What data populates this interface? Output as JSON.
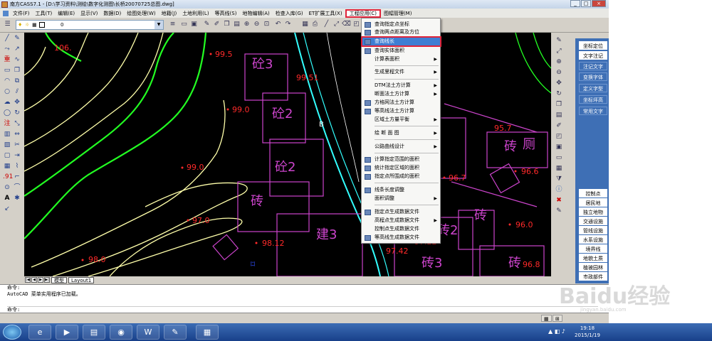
{
  "window": {
    "title": "南方CASS7.1 - [D:\\学习资料\\测绘\\数字化测图\\长桥20070725总图.dwg]",
    "buttons": {
      "min": "_",
      "max": "□",
      "close": "×"
    }
  },
  "menubar": {
    "items": [
      "文件(F)",
      "工具(T)",
      "编辑(E)",
      "显示(V)",
      "数据(D)",
      "绘图处理(W)",
      "地籍(J)",
      "土地利用(L)",
      "等高线(S)",
      "地物编辑(A)",
      "检查入库(G)",
      "ET扩展工具(X)",
      "工程应用(C)",
      "图幅管理(M)"
    ],
    "active": "工程应用(C)"
  },
  "toolbar": {
    "layer_value": "0"
  },
  "dropdown": {
    "items": [
      {
        "label": "查询指定点坐标",
        "icon": "point-query-icon"
      },
      {
        "label": "查询两点距离及方位",
        "icon": "distance-query-icon"
      },
      {
        "label": "查询线长",
        "icon": "line-length-icon",
        "highlighted": true
      },
      {
        "label": "查询实体面积",
        "icon": "area-query-icon"
      },
      {
        "label": "计算表面积",
        "submenu": true
      },
      {
        "label": "生成里程文件",
        "submenu": true
      },
      {
        "label": "DTM法土方计算",
        "submenu": true
      },
      {
        "label": "断面法土方计算",
        "submenu": true
      },
      {
        "label": "方格网法土方计算",
        "icon": "grid-icon"
      },
      {
        "label": "等高线法土方计算",
        "icon": "contour-icon"
      },
      {
        "label": "区域土方量平衡",
        "submenu": true
      },
      {
        "label": "绘 断 面 图",
        "submenu": true
      },
      {
        "label": "公路曲线设计",
        "submenu": true
      },
      {
        "label": "计算指定范围的面积",
        "icon": "range-area-icon"
      },
      {
        "label": "统计指定区域的面积",
        "icon": "stat-area-icon"
      },
      {
        "label": "指定点所围成的面积",
        "icon": "point-area-icon"
      },
      {
        "label": "线条长度调整",
        "icon": "line-adjust-icon"
      },
      {
        "label": "面积调整",
        "submenu": true
      },
      {
        "label": "指定点生成数据文件",
        "icon": "point-file-icon"
      },
      {
        "label": "高程点生成数据文件",
        "submenu": true
      },
      {
        "label": "控制点生成数据文件"
      },
      {
        "label": "等高线生成数据文件",
        "icon": "contour-file-icon"
      }
    ]
  },
  "canvas": {
    "elevations": [
      "106.",
      "99.5",
      "99.51",
      "99.0",
      "99.0",
      "97.0",
      "98.12",
      "98.0",
      "97.42",
      "97.22",
      "96.7",
      "96.6",
      "96.0",
      "95.7",
      "96.8"
    ],
    "buildings": [
      "砼3",
      "砼2",
      "砼2",
      "砖",
      "砖",
      "建3",
      "砖",
      "砖",
      "砖2",
      "砖3",
      "砖",
      "厕",
      "砖"
    ],
    "small_marks": [
      "B"
    ]
  },
  "tabs": {
    "model": "模型",
    "layout": "Layout1",
    "nav": [
      "|◀",
      "◀",
      "▶",
      "▶|"
    ]
  },
  "right_panel": {
    "top": [
      "坐标定位",
      "文字注记",
      "注记文字",
      "变换字体",
      "定义字型",
      "坐标坪高",
      "常用文字"
    ],
    "bottom": [
      "控制点",
      "居民地",
      "独立地物",
      "交通设施",
      "管线设施",
      "水系设施",
      "境界线",
      "地貌土质",
      "植被园林",
      "市政部件"
    ]
  },
  "command": {
    "lines": [
      "命令:",
      "AutoCAD 菜单实用程序已加载。",
      "命令:"
    ]
  },
  "taskbar": {
    "time": "19:18",
    "date": "2015/1/19"
  },
  "watermark": {
    "text": "Baidu经验",
    "sub": "jingyan.baidu.com"
  },
  "colors": {
    "canvas_bg": "#000000",
    "contour": "#ffffaa",
    "contour_green": "#22ff22",
    "building": "#cc44cc",
    "elev": "#ff2a2a",
    "road": "#33ffff",
    "accent": "#e0243a"
  }
}
